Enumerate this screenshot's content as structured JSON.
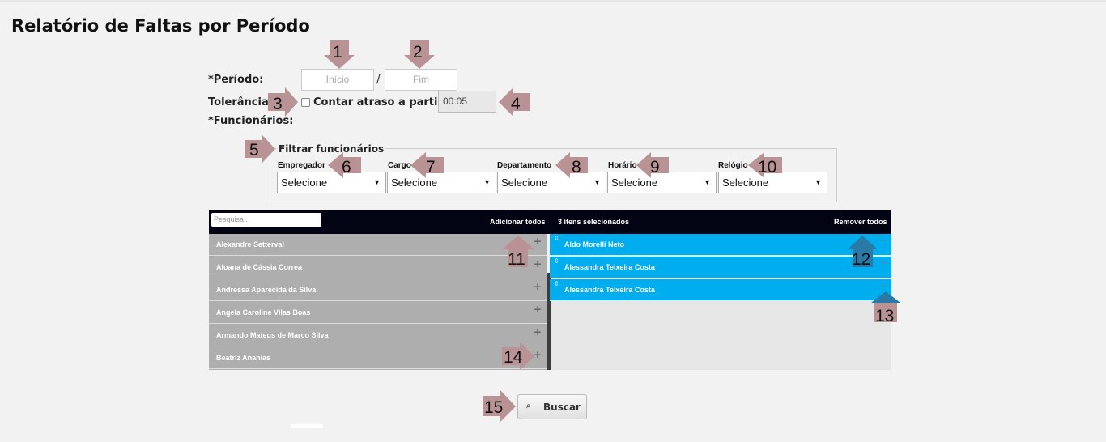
{
  "page": {
    "title": "Relatório de Faltas por Período"
  },
  "form": {
    "periodo_label": "*Período:",
    "inicio_placeholder": "Início",
    "fim_placeholder": "Fim",
    "separator": "/",
    "tolerancia_label": "Tolerância:",
    "atraso_checkbox_label": "Contar atraso a partir de:",
    "atraso_value": "00:05",
    "funcionarios_label": "*Funcionários:"
  },
  "filter": {
    "legend": "Filtrar funcionários",
    "fields": [
      {
        "label": "Empregador",
        "value": "Selecione"
      },
      {
        "label": "Cargo",
        "value": "Selecione"
      },
      {
        "label": "Departamento",
        "value": "Selecione"
      },
      {
        "label": "Horário",
        "value": "Selecione"
      },
      {
        "label": "Relógio",
        "value": "Selecione"
      }
    ]
  },
  "multiselect": {
    "search_placeholder": "Pesquisa...",
    "add_all": "Adicionar todos",
    "selected_count": "3 itens selecionados",
    "remove_all": "Remover todos",
    "available": [
      "Alexandre Setterval",
      "Aloana de Cássia Correa",
      "Andressa Aparecida da Silva",
      "Angela Caroline Vilas Boas",
      "Armando Mateus de Marco Silva",
      "Beatriz Ananias"
    ],
    "selected": [
      "Aldo Morelli Neto",
      "Alessandra Teixeira Costa",
      "Alessandra Teixeira Costa"
    ]
  },
  "actions": {
    "search_label": "Buscar",
    "search_icon": "magnifier-icon"
  },
  "annotations": [
    "1",
    "2",
    "3",
    "4",
    "5",
    "6",
    "7",
    "8",
    "9",
    "10",
    "11",
    "12",
    "13",
    "14",
    "15"
  ],
  "colors": {
    "header": "#020413",
    "selected_row": "#00adef",
    "available_row": "#aeaeae",
    "annotation_arrow": "#b89295",
    "annotation_arrow_blue": "#2a7aa8"
  }
}
